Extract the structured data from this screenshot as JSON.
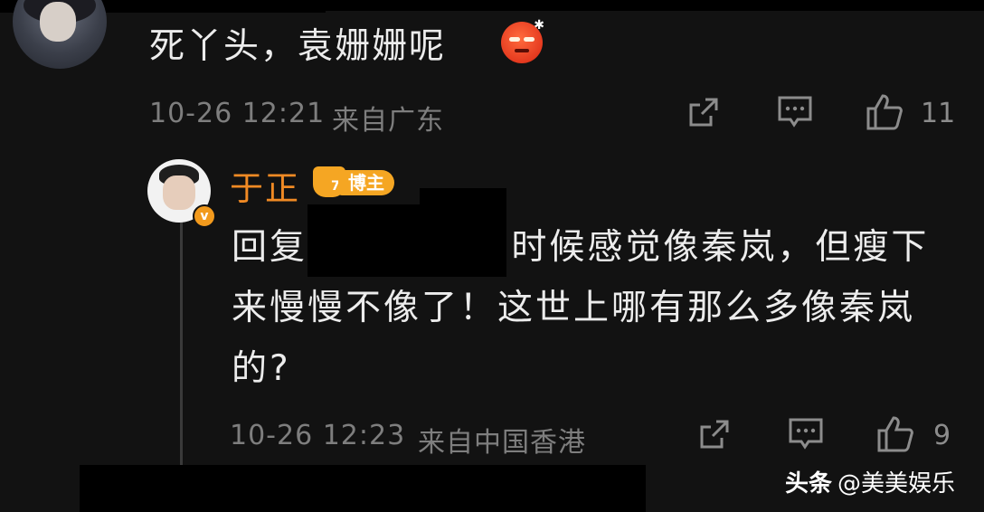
{
  "top_comment": {
    "text": "死丫头，袁姗姗呢",
    "emoji": "angry-face-emoji",
    "timestamp": "10-26 12:21",
    "location": "来自广东",
    "like_count": "11"
  },
  "reply": {
    "username": "于正",
    "badge_number": "7",
    "badge_label": "博主",
    "verified_mark": "v",
    "body": "回复                         刚看到她的时候感觉像秦岚，但瘦下来慢慢不像了！这世上哪有那么多像秦岚的?",
    "timestamp": "10-26 12:23",
    "location": "来自中国香港",
    "like_count": "9"
  },
  "watermark": {
    "brand": "头条",
    "account": "@美美娱乐"
  },
  "colors": {
    "background": "#121212",
    "username": "#f08a24",
    "badge": "#f5a623",
    "meta_text": "#7e7e7e"
  }
}
